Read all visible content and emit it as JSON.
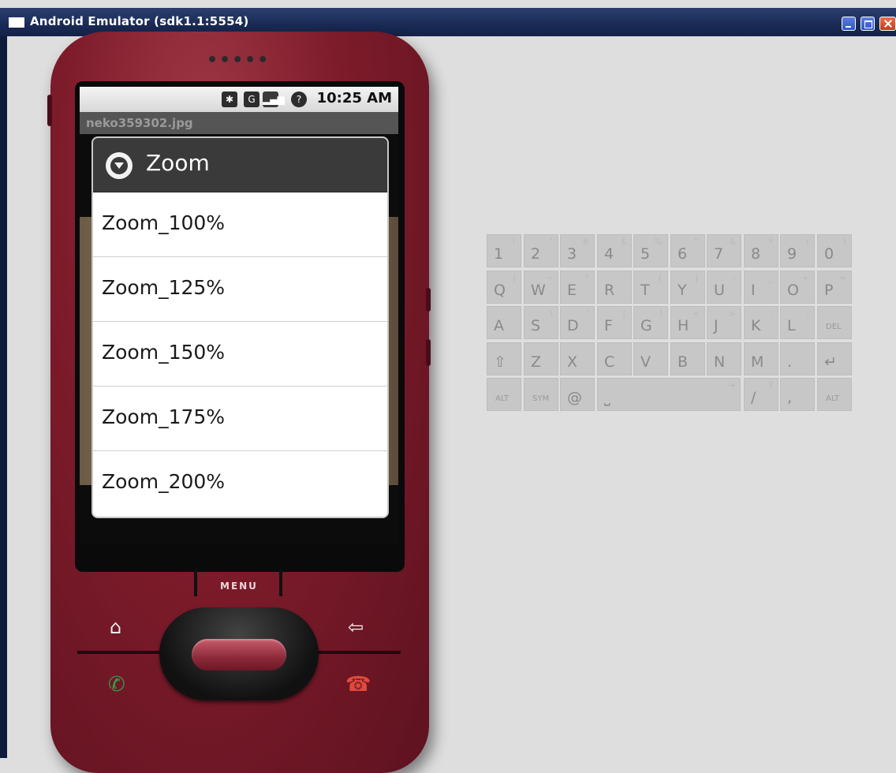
{
  "window": {
    "title": "Android Emulator (sdk1.1:5554)"
  },
  "status_bar": {
    "time": "10:25 AM",
    "icons": [
      "bluetooth-icon",
      "network-g-icon",
      "signal-bars-icon",
      "battery-unknown-icon"
    ]
  },
  "app": {
    "title": "neko359302.jpg"
  },
  "dialog": {
    "title": "Zoom",
    "icon": "dropdown-circle-icon",
    "options": [
      "Zoom_100%",
      "Zoom_125%",
      "Zoom_150%",
      "Zoom_175%",
      "Zoom_200%"
    ]
  },
  "phone": {
    "speaker": "•••••",
    "menu_label": "MENU",
    "buttons": [
      "home-icon",
      "back-icon",
      "call-icon",
      "end-call-icon"
    ]
  },
  "keyboard": {
    "rows": [
      [
        [
          "1",
          "!"
        ],
        [
          "2",
          "\""
        ],
        [
          "3",
          "#"
        ],
        [
          "4",
          "$"
        ],
        [
          "5",
          "%"
        ],
        [
          "6",
          "^"
        ],
        [
          "7",
          "&"
        ],
        [
          "8",
          "*"
        ],
        [
          "9",
          "("
        ],
        [
          "0",
          ")"
        ]
      ],
      [
        [
          "Q",
          "|"
        ],
        [
          "W",
          "~"
        ],
        [
          "E",
          "\""
        ],
        [
          "R",
          "`"
        ],
        [
          "T",
          "{"
        ],
        [
          "Y",
          "}"
        ],
        [
          "U",
          "-"
        ],
        [
          "I",
          "_"
        ],
        [
          "O",
          "+"
        ],
        [
          "P",
          "="
        ]
      ],
      [
        [
          "A",
          ""
        ],
        [
          "S",
          "\\"
        ],
        [
          "D",
          "'"
        ],
        [
          "F",
          "["
        ],
        [
          "G",
          "]"
        ],
        [
          "H",
          "<"
        ],
        [
          "J",
          ">"
        ],
        [
          "K",
          ";"
        ],
        [
          "L",
          ":"
        ],
        [
          "DEL",
          ""
        ]
      ],
      [
        [
          "⇧",
          ""
        ],
        [
          "Z",
          ""
        ],
        [
          "X",
          ""
        ],
        [
          "C",
          ""
        ],
        [
          "V",
          ""
        ],
        [
          "B",
          ""
        ],
        [
          "N",
          ""
        ],
        [
          "M",
          ""
        ],
        [
          ".",
          ""
        ],
        [
          "↵",
          ""
        ]
      ],
      [
        [
          "ALT",
          ""
        ],
        [
          "SYM",
          ""
        ],
        [
          "@",
          ""
        ],
        [
          "⎵",
          "⇥"
        ],
        [
          "/",
          "?"
        ],
        [
          ",",
          ""
        ],
        [
          "ALT",
          ""
        ]
      ]
    ]
  }
}
